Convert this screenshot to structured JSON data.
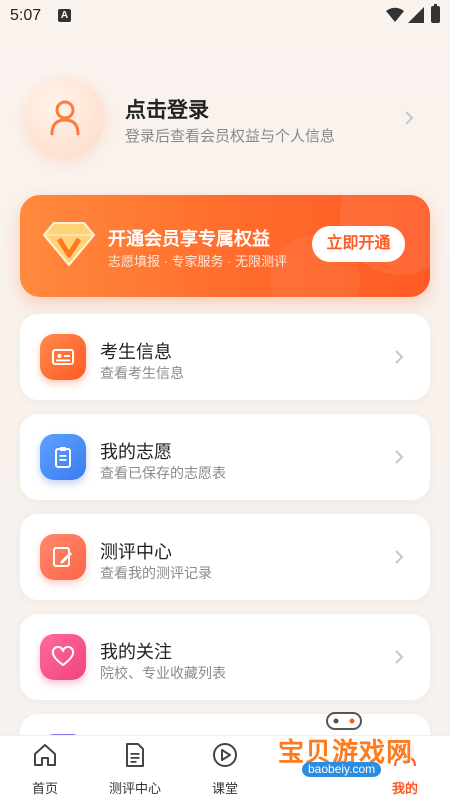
{
  "status_bar": {
    "time": "5:07",
    "notification_icon": "A"
  },
  "profile": {
    "title": "点击登录",
    "subtitle": "登录后查看会员权益与个人信息"
  },
  "member_banner": {
    "title": "开通会员享专属权益",
    "subtitle": "志愿填报 · 专家服务 · 无限测评",
    "button": "立即开通"
  },
  "menu": [
    {
      "title": "考生信息",
      "subtitle": "查看考生信息",
      "icon": "id-card-icon"
    },
    {
      "title": "我的志愿",
      "subtitle": "查看已保存的志愿表",
      "icon": "clipboard-icon"
    },
    {
      "title": "测评中心",
      "subtitle": "查看我的测评记录",
      "icon": "edit-icon"
    },
    {
      "title": "我的关注",
      "subtitle": "院校、专业收藏列表",
      "icon": "heart-icon"
    }
  ],
  "bottom_nav": [
    {
      "label": "首页",
      "icon": "home-icon"
    },
    {
      "label": "测评中心",
      "icon": "document-icon"
    },
    {
      "label": "课堂",
      "icon": "play-icon"
    },
    {
      "label": "",
      "icon": "hidden"
    },
    {
      "label": "我的",
      "icon": "user-icon",
      "active": true
    }
  ],
  "watermark": {
    "text": "宝贝游戏网",
    "url": "baobeiy.com"
  },
  "colors": {
    "accent": "#ff5a24",
    "background": "#f8f1ec"
  }
}
